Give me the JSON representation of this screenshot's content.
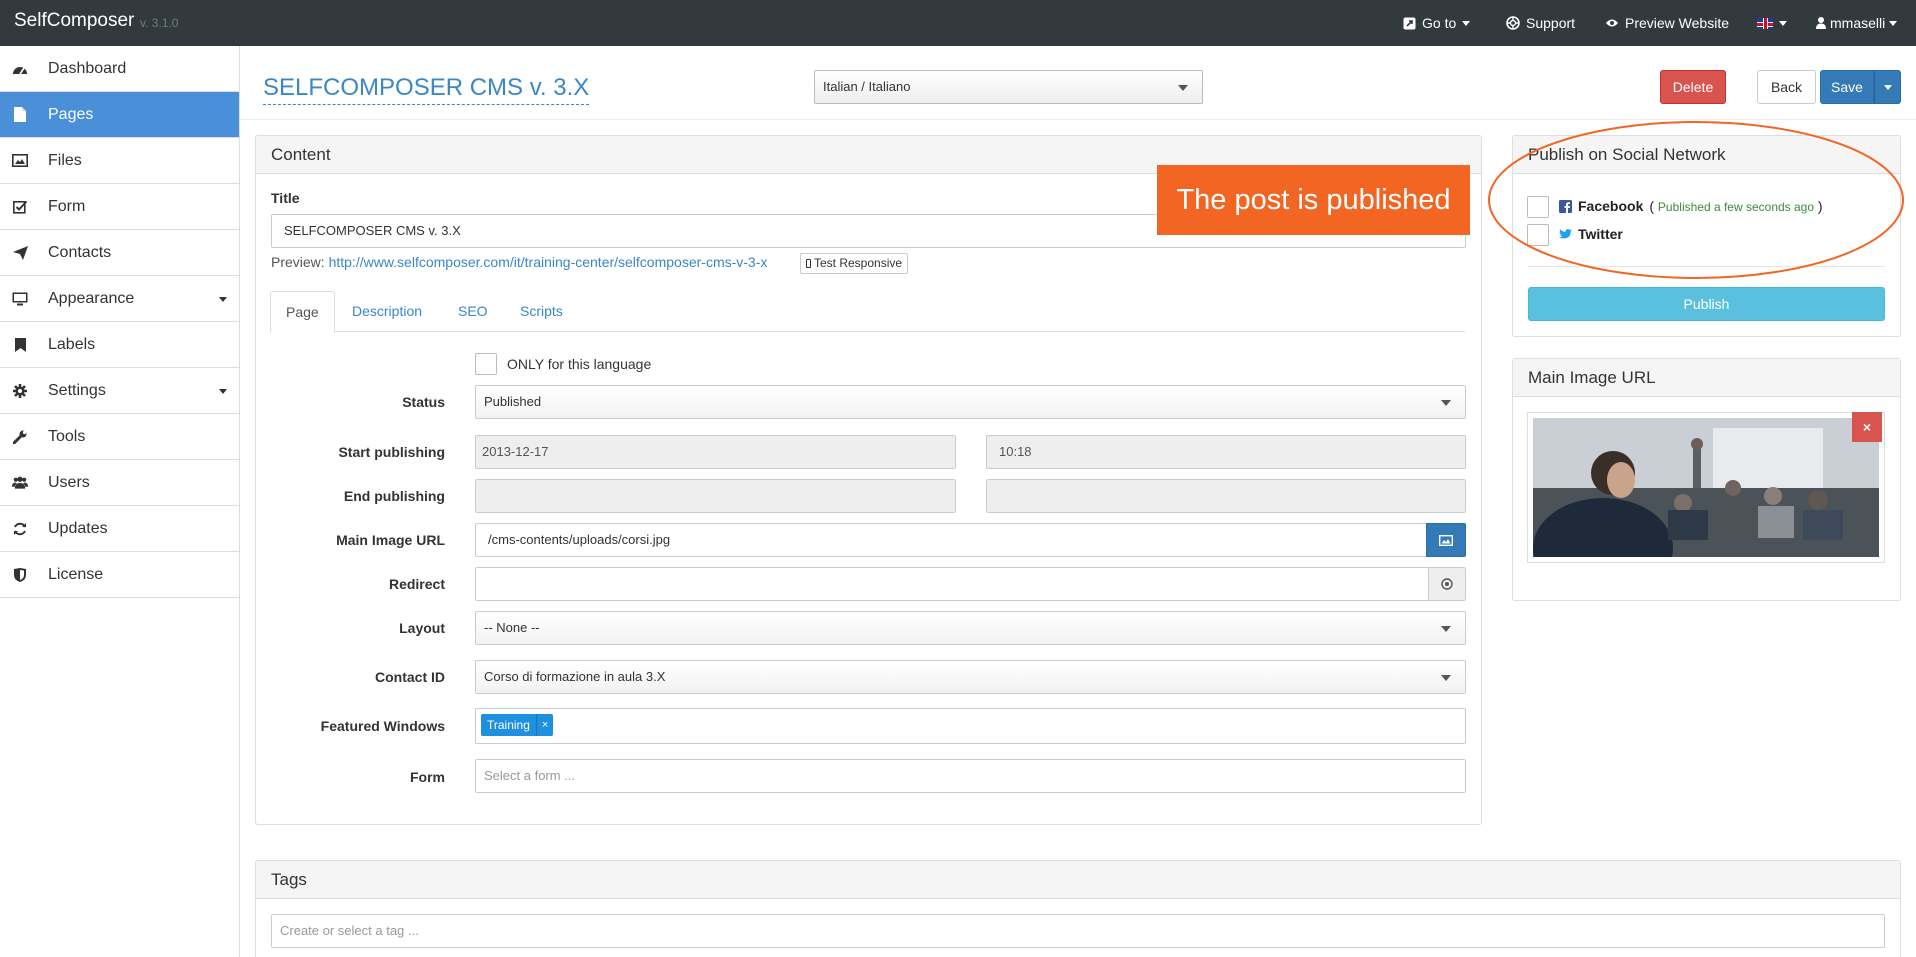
{
  "app": {
    "brand": "SelfComposer",
    "version": "v. 3.1.0"
  },
  "navbar": {
    "goto": "Go to",
    "support": "Support",
    "preview": "Preview Website",
    "user": "mmaselli"
  },
  "sidebar": {
    "items": [
      {
        "label": "Dashboard",
        "icon": "dashboard-icon"
      },
      {
        "label": "Pages",
        "icon": "file-icon",
        "active": true
      },
      {
        "label": "Files",
        "icon": "image-icon"
      },
      {
        "label": "Form",
        "icon": "checkbox-icon"
      },
      {
        "label": "Contacts",
        "icon": "send-icon"
      },
      {
        "label": "Appearance",
        "icon": "monitor-icon",
        "has_caret": true
      },
      {
        "label": "Labels",
        "icon": "bookmark-icon"
      },
      {
        "label": "Settings",
        "icon": "gear-icon",
        "has_caret": true
      },
      {
        "label": "Tools",
        "icon": "wrench-icon"
      },
      {
        "label": "Users",
        "icon": "users-icon"
      },
      {
        "label": "Updates",
        "icon": "refresh-icon"
      },
      {
        "label": "License",
        "icon": "shield-icon"
      }
    ]
  },
  "header": {
    "title": "SELFCOMPOSER CMS v. 3.X",
    "language": "Italian / Italiano",
    "delete": "Delete",
    "back": "Back",
    "save": "Save"
  },
  "content": {
    "panel_title": "Content",
    "title_label": "Title",
    "title_value": "SELFCOMPOSER CMS v. 3.X",
    "preview_label": "Preview:",
    "preview_url": "http://www.selfcomposer.com/it/training-center/selfcomposer-cms-v-3-x",
    "test_responsive": "Test Responsive",
    "tabs": [
      "Page",
      "Description",
      "SEO",
      "Scripts"
    ],
    "only_language": "ONLY for this language",
    "fields": {
      "status": {
        "label": "Status",
        "value": "Published"
      },
      "start_publishing": {
        "label": "Start publishing",
        "date": "2013-12-17",
        "time": "10:18"
      },
      "end_publishing": {
        "label": "End publishing",
        "date": "",
        "time": ""
      },
      "main_image_url": {
        "label": "Main Image URL",
        "value": "/cms-contents/uploads/corsi.jpg"
      },
      "redirect": {
        "label": "Redirect",
        "value": ""
      },
      "layout": {
        "label": "Layout",
        "value": "-- None --"
      },
      "contact_id": {
        "label": "Contact ID",
        "value": "Corso di formazione in aula 3.X"
      },
      "featured_windows": {
        "label": "Featured Windows",
        "tag": "Training",
        "tag_remove": "×"
      },
      "form": {
        "label": "Form",
        "placeholder": "Select a form ..."
      }
    }
  },
  "overlay": {
    "text": "The post is published",
    "color": "#f26522"
  },
  "social": {
    "panel_title": "Publish on Social Network",
    "facebook": "Facebook",
    "facebook_status_open": "(",
    "facebook_status": "Published a few seconds ago",
    "facebook_status_close": ")",
    "twitter": "Twitter",
    "publish": "Publish"
  },
  "main_image": {
    "panel_title": "Main Image URL",
    "remove": "×"
  },
  "tags": {
    "panel_title": "Tags",
    "placeholder": "Create or select a tag ..."
  },
  "colors": {
    "accent": "#4a90d9",
    "danger": "#d9534f",
    "primary": "#337ab7",
    "info": "#5bc0de",
    "navbar": "#323a3e",
    "annotation": "#f26522"
  }
}
